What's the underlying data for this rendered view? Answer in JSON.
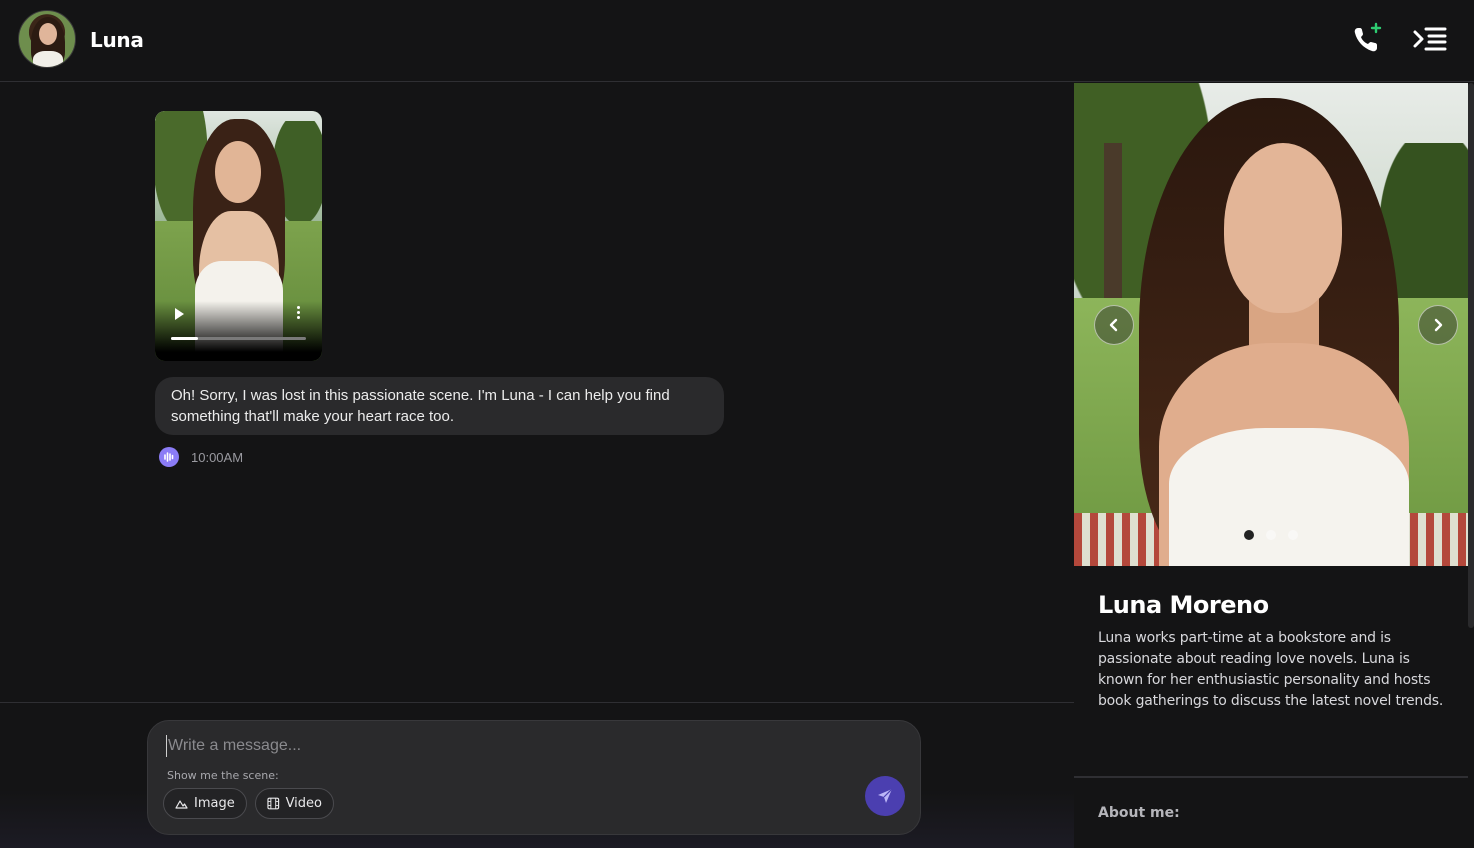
{
  "header": {
    "name": "Luna",
    "avatar_icon": "avatar-photo",
    "call_icon": "phone-call-icon",
    "menu_icon": "collapse-menu-icon"
  },
  "chat": {
    "video": {
      "play_icon": "play-icon",
      "more_icon": "more-vertical-icon",
      "progress_fraction": 0.2
    },
    "message": {
      "text": "Oh! Sorry, I was lost in this passionate scene. I'm Luna - I can help you find something that'll make your heart race too.",
      "time": "10:00AM",
      "voice_icon": "audio-wave-icon"
    }
  },
  "composer": {
    "placeholder": "Write a message...",
    "scene_label": "Show me the scene:",
    "image_chip": "Image",
    "video_chip": "Video",
    "send_icon": "send-icon"
  },
  "profile": {
    "name": "Luna Moreno",
    "bio": "Luna works part-time at a bookstore and is passionate about reading love novels. Luna is known for her enthusiastic personality and hosts book gatherings to discuss the latest novel trends.",
    "about_label": "About me:",
    "carousel_active": 1,
    "carousel_count": 3
  },
  "colors": {
    "background": "#141415",
    "bubble": "#2a2a2c",
    "accent": "#8b7cf6",
    "send": "#4b3fb0",
    "call_accent": "#2ecc71"
  }
}
